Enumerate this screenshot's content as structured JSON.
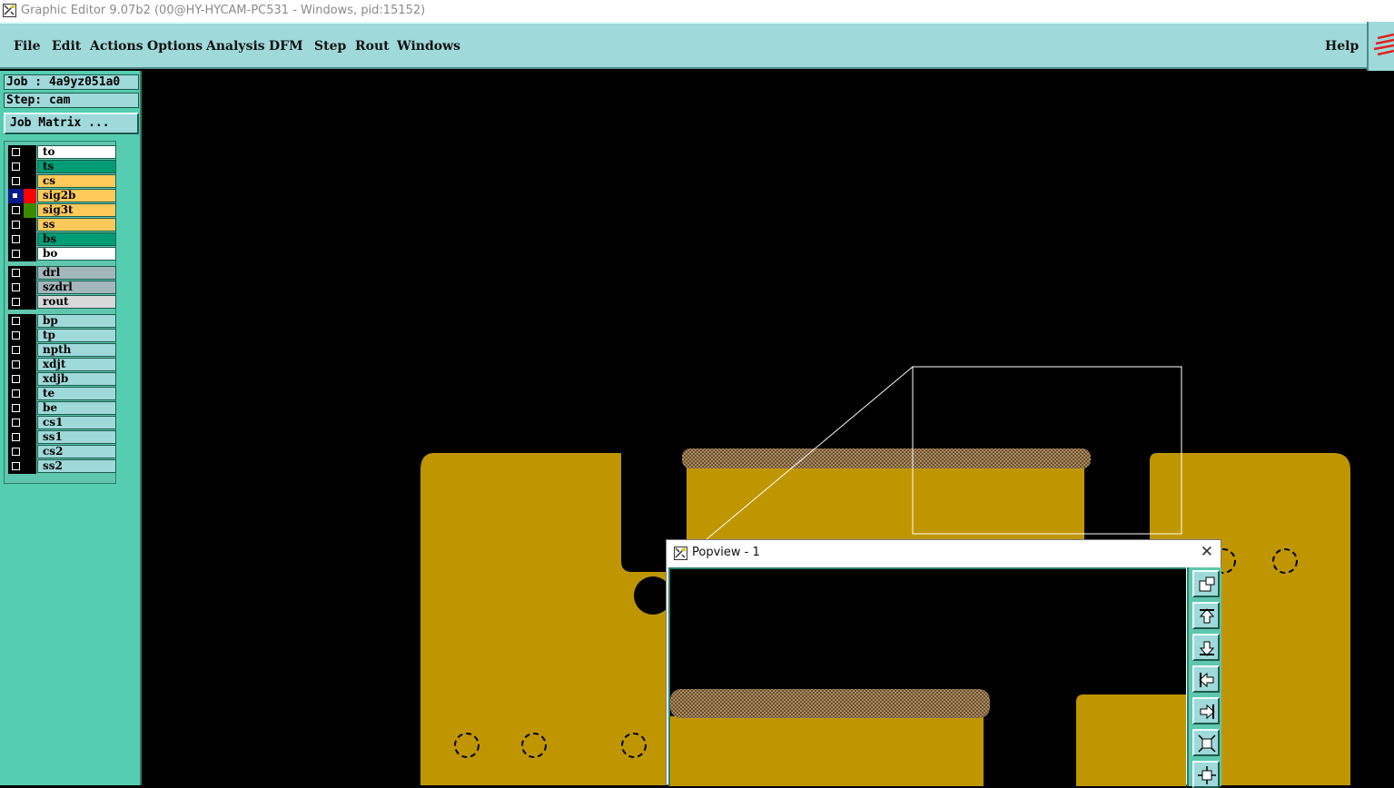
{
  "window": {
    "title": "Graphic Editor 9.07b2 (00@HY-HYCAM-PC531 - Windows, pid:15152)"
  },
  "menu": {
    "items": [
      "File",
      "Edit",
      "Actions",
      "Options",
      "Analysis",
      "DFM",
      "Step",
      "Rout",
      "Windows"
    ],
    "help": "Help"
  },
  "job": {
    "job_label": "Job : 4a9yz051a0",
    "step_label": "Step: cam",
    "matrix_button": "Job Matrix ..."
  },
  "layers": [
    {
      "name": "to",
      "bg": "#ffffff",
      "swatch": "#000000",
      "active": false
    },
    {
      "name": "ts",
      "bg": "#009c74",
      "swatch": "#000000",
      "active": false
    },
    {
      "name": "cs",
      "bg": "#ffc95a",
      "swatch": "#000000",
      "active": false
    },
    {
      "name": "sig2b",
      "bg": "#ffc95a",
      "swatch": "#ff0000",
      "active": true
    },
    {
      "name": "sig3t",
      "bg": "#ffc95a",
      "swatch": "#3a8a00",
      "active": false
    },
    {
      "name": "ss",
      "bg": "#ffc95a",
      "swatch": "#000000",
      "active": false
    },
    {
      "name": "bs",
      "bg": "#009c74",
      "swatch": "#000000",
      "active": false
    },
    {
      "name": "bo",
      "bg": "#ffffff",
      "swatch": "#000000",
      "active": false
    },
    {
      "name": "drl",
      "bg": "#a3b6bc",
      "swatch": "#000000",
      "active": false
    },
    {
      "name": "szdrl",
      "bg": "#a3b6bc",
      "swatch": "#000000",
      "active": false
    },
    {
      "name": "rout",
      "bg": "#d8d8d8",
      "swatch": "#000000",
      "active": false
    },
    {
      "name": "bp",
      "bg": "#9fd9da",
      "swatch": "#000000",
      "active": false
    },
    {
      "name": "tp",
      "bg": "#9fd9da",
      "swatch": "#000000",
      "active": false
    },
    {
      "name": "npth",
      "bg": "#9fd9da",
      "swatch": "#000000",
      "active": false
    },
    {
      "name": "xdjt",
      "bg": "#9fd9da",
      "swatch": "#000000",
      "active": false
    },
    {
      "name": "xdjb",
      "bg": "#9fd9da",
      "swatch": "#000000",
      "active": false
    },
    {
      "name": "te",
      "bg": "#9fd9da",
      "swatch": "#000000",
      "active": false
    },
    {
      "name": "be",
      "bg": "#9fd9da",
      "swatch": "#000000",
      "active": false
    },
    {
      "name": "cs1",
      "bg": "#9fd9da",
      "swatch": "#000000",
      "active": false
    },
    {
      "name": "ss1",
      "bg": "#9fd9da",
      "swatch": "#000000",
      "active": false
    },
    {
      "name": "cs2",
      "bg": "#9fd9da",
      "swatch": "#000000",
      "active": false
    },
    {
      "name": "ss2",
      "bg": "#9fd9da",
      "swatch": "#000000",
      "active": false
    }
  ],
  "popview": {
    "title": "Popview - 1",
    "tools": [
      "zoom-window-icon",
      "pan-up-icon",
      "pan-down-icon",
      "pan-left-icon",
      "pan-right-icon",
      "zoom-in-icon",
      "zoom-out-icon"
    ]
  },
  "colors": {
    "copper": "#bf9600",
    "menu_bg": "#9fd9da",
    "panel_bg": "#55cdb0"
  }
}
